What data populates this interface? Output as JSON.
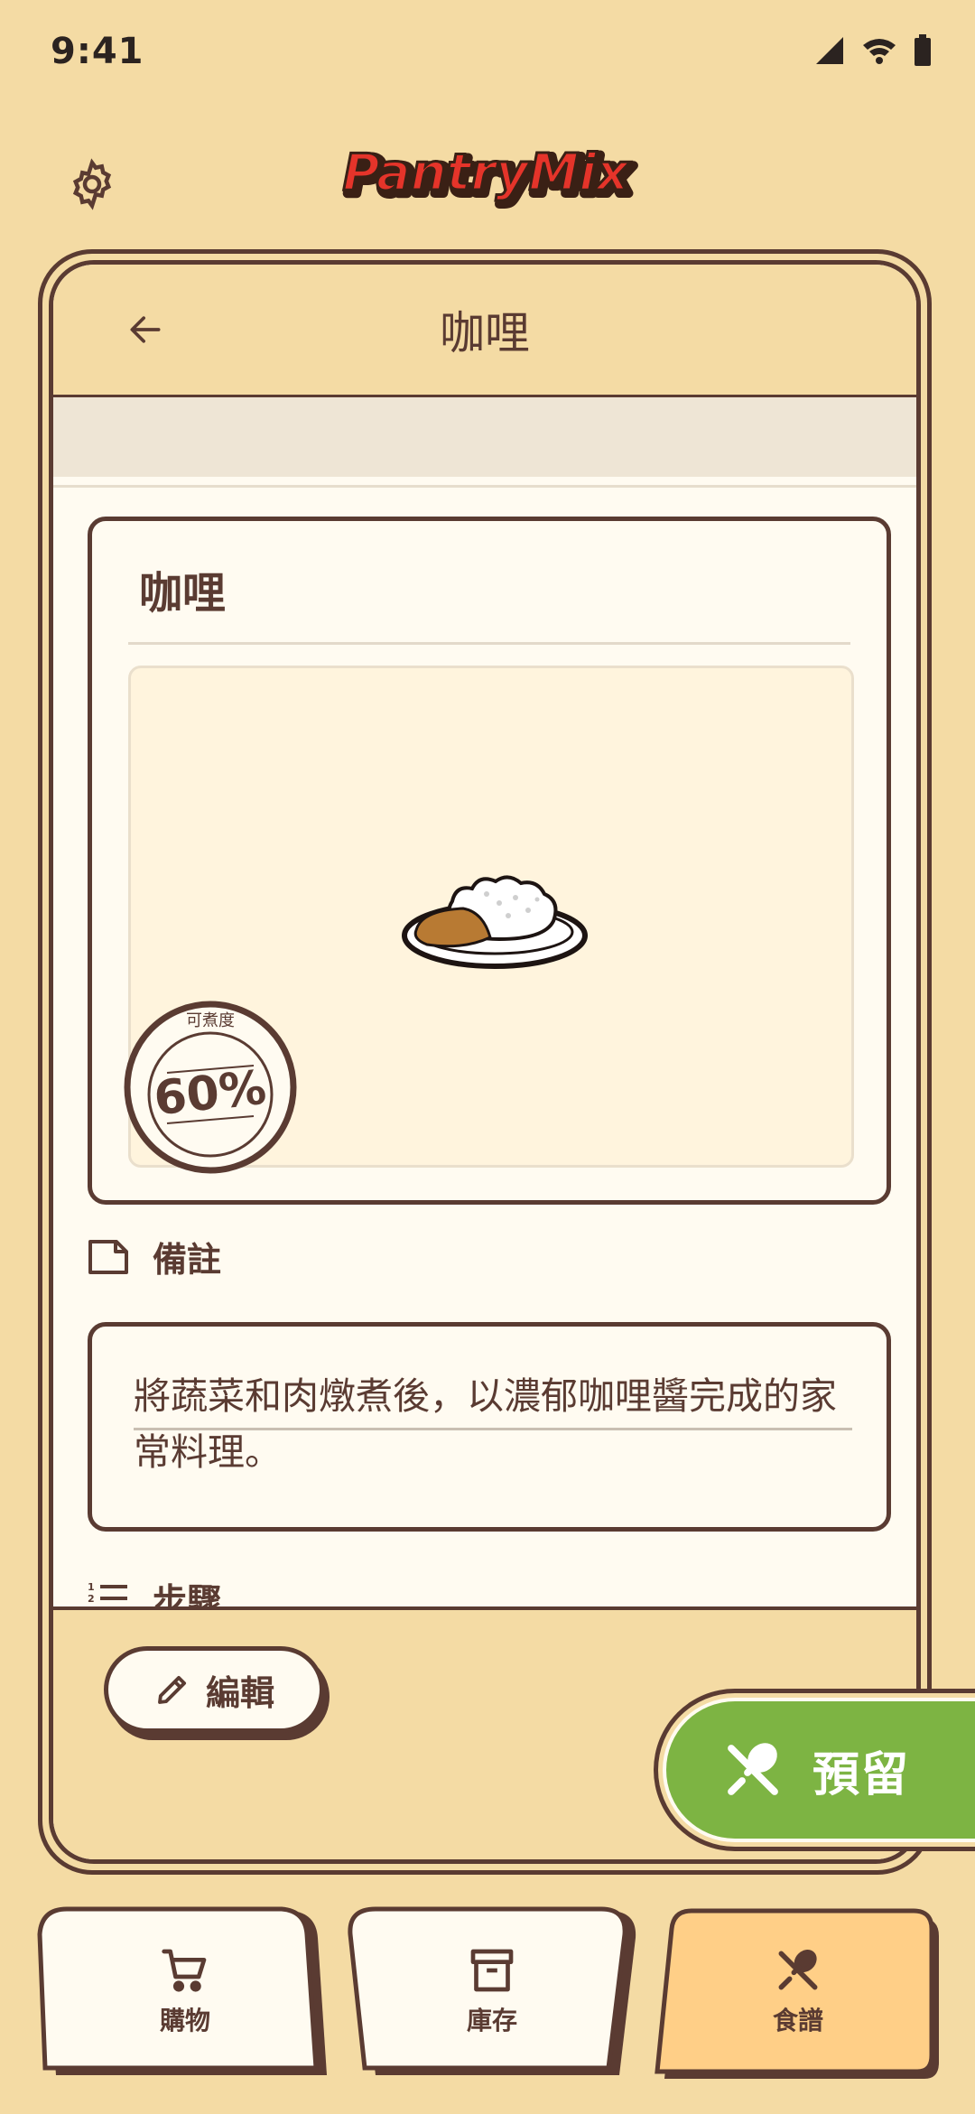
{
  "status_bar": {
    "time": "9:41"
  },
  "app": {
    "logo_text": "PantryMix"
  },
  "header": {
    "title": "咖哩"
  },
  "recipe": {
    "name": "咖哩",
    "cookability_label": "可煮度",
    "cookability_value": "60%"
  },
  "notes": {
    "label": "備註",
    "text": "將蔬菜和肉燉煮後，以濃郁咖哩醬完成的家常料理。"
  },
  "steps": {
    "label": "步驟"
  },
  "actions": {
    "edit_label": "編輯",
    "reserve_label": "預留"
  },
  "nav": {
    "items": [
      {
        "label": "購物",
        "icon": "cart-icon"
      },
      {
        "label": "庫存",
        "icon": "archive-icon"
      },
      {
        "label": "食譜",
        "icon": "utensils-icon"
      }
    ],
    "active_index": 2
  },
  "colors": {
    "background": "#f4dba4",
    "surface": "#fffbf1",
    "ink": "#5a3b32",
    "accent_green": "#7db443",
    "active_tab": "#ffcf87"
  }
}
